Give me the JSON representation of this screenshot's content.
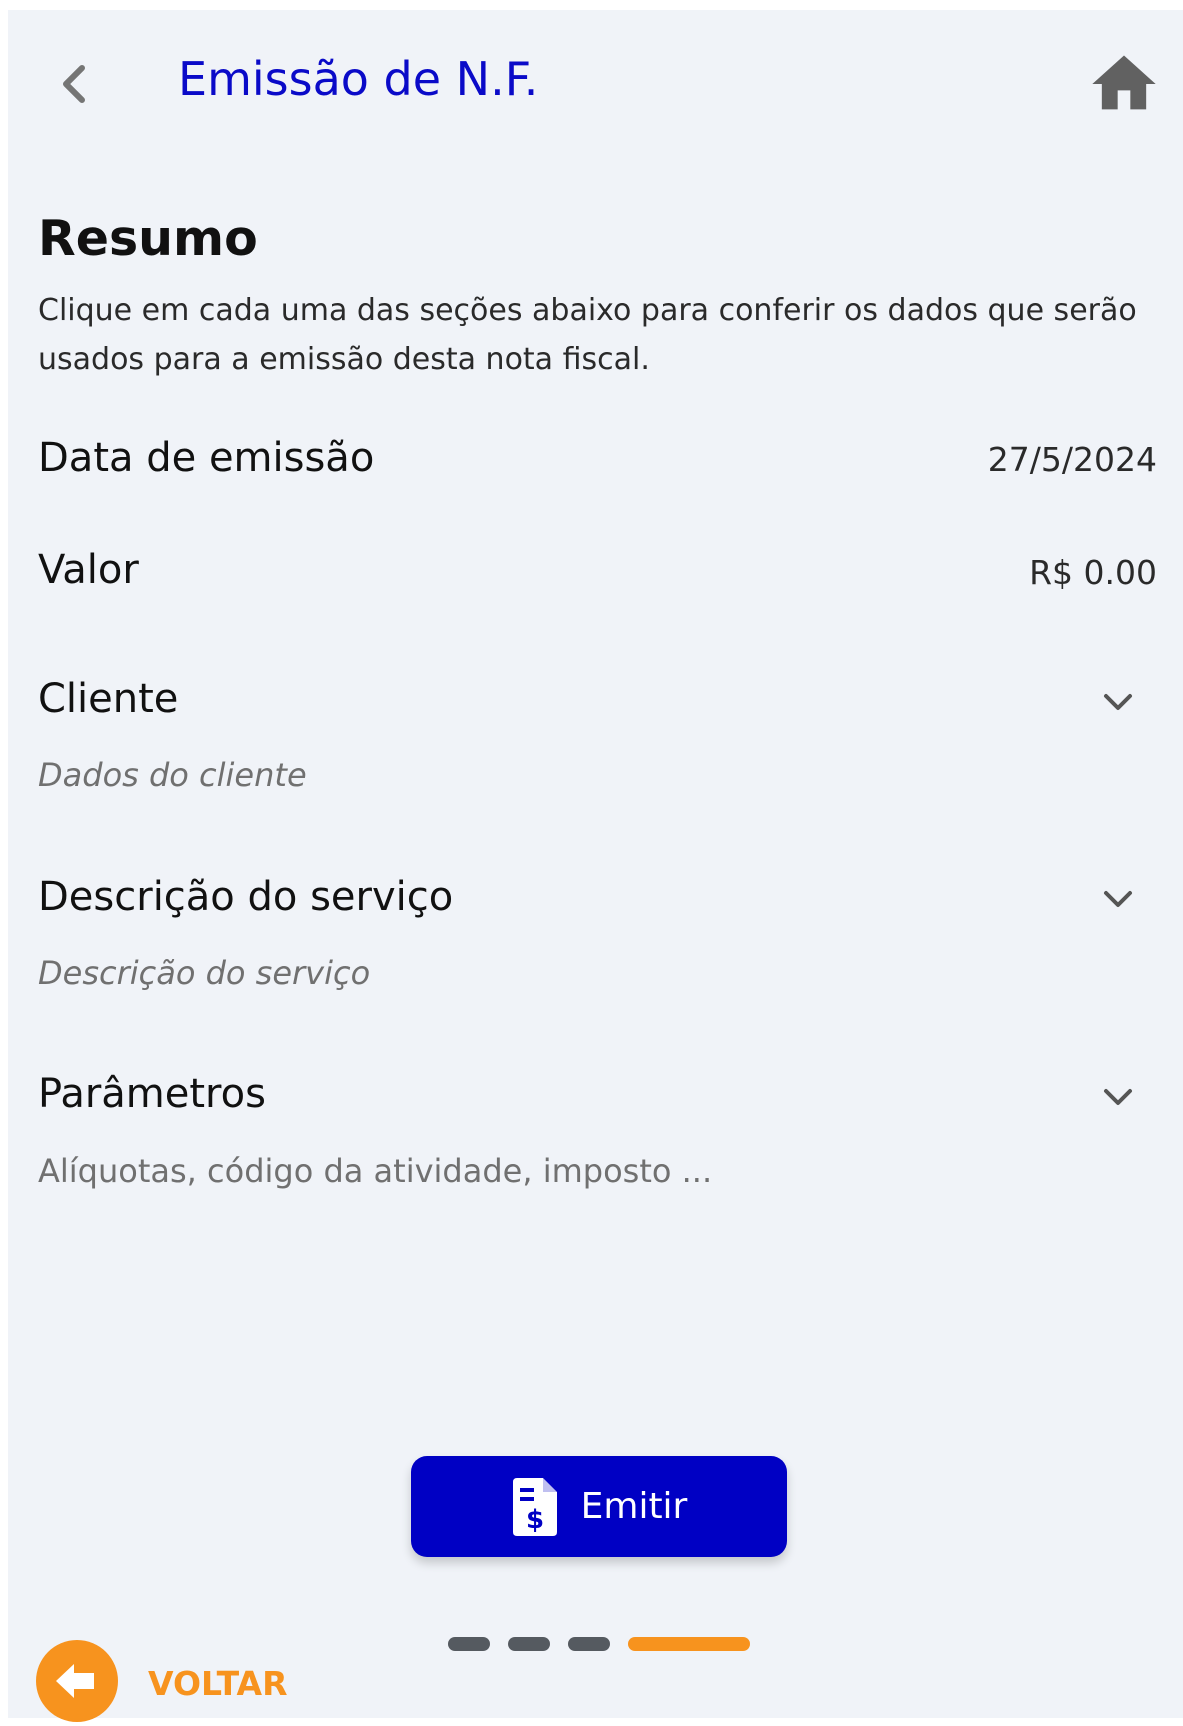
{
  "header": {
    "title": "Emissão de N.F.",
    "back_icon": "chevron-left-icon",
    "home_icon": "home-icon"
  },
  "summary": {
    "title": "Resumo",
    "description": "Clique em cada uma das seções abaixo para conferir os dados que serão usados para a emissão desta nota fiscal."
  },
  "fields": {
    "issue_date_label": "Data de emissão",
    "issue_date_value": "27/5/2024",
    "amount_label": "Valor",
    "amount_value": "R$ 0.00"
  },
  "sections": [
    {
      "label": "Cliente",
      "sub": "Dados do cliente"
    },
    {
      "label": "Descrição do serviço",
      "sub": "Descrição do serviço"
    },
    {
      "label": "Parâmetros",
      "sub": "Alíquotas, código da atividade, imposto ..."
    }
  ],
  "actions": {
    "emit_label": "Emitir",
    "emit_icon": "invoice-dollar-icon",
    "back_label": "VOLTAR",
    "back_icon": "arrow-left-circle-icon"
  },
  "stepper": {
    "total": 4,
    "current": 4
  },
  "colors": {
    "accent_blue": "#0000c4",
    "title_blue": "#0a0ac8",
    "accent_orange": "#f7931e",
    "background": "#f0f3f8"
  }
}
